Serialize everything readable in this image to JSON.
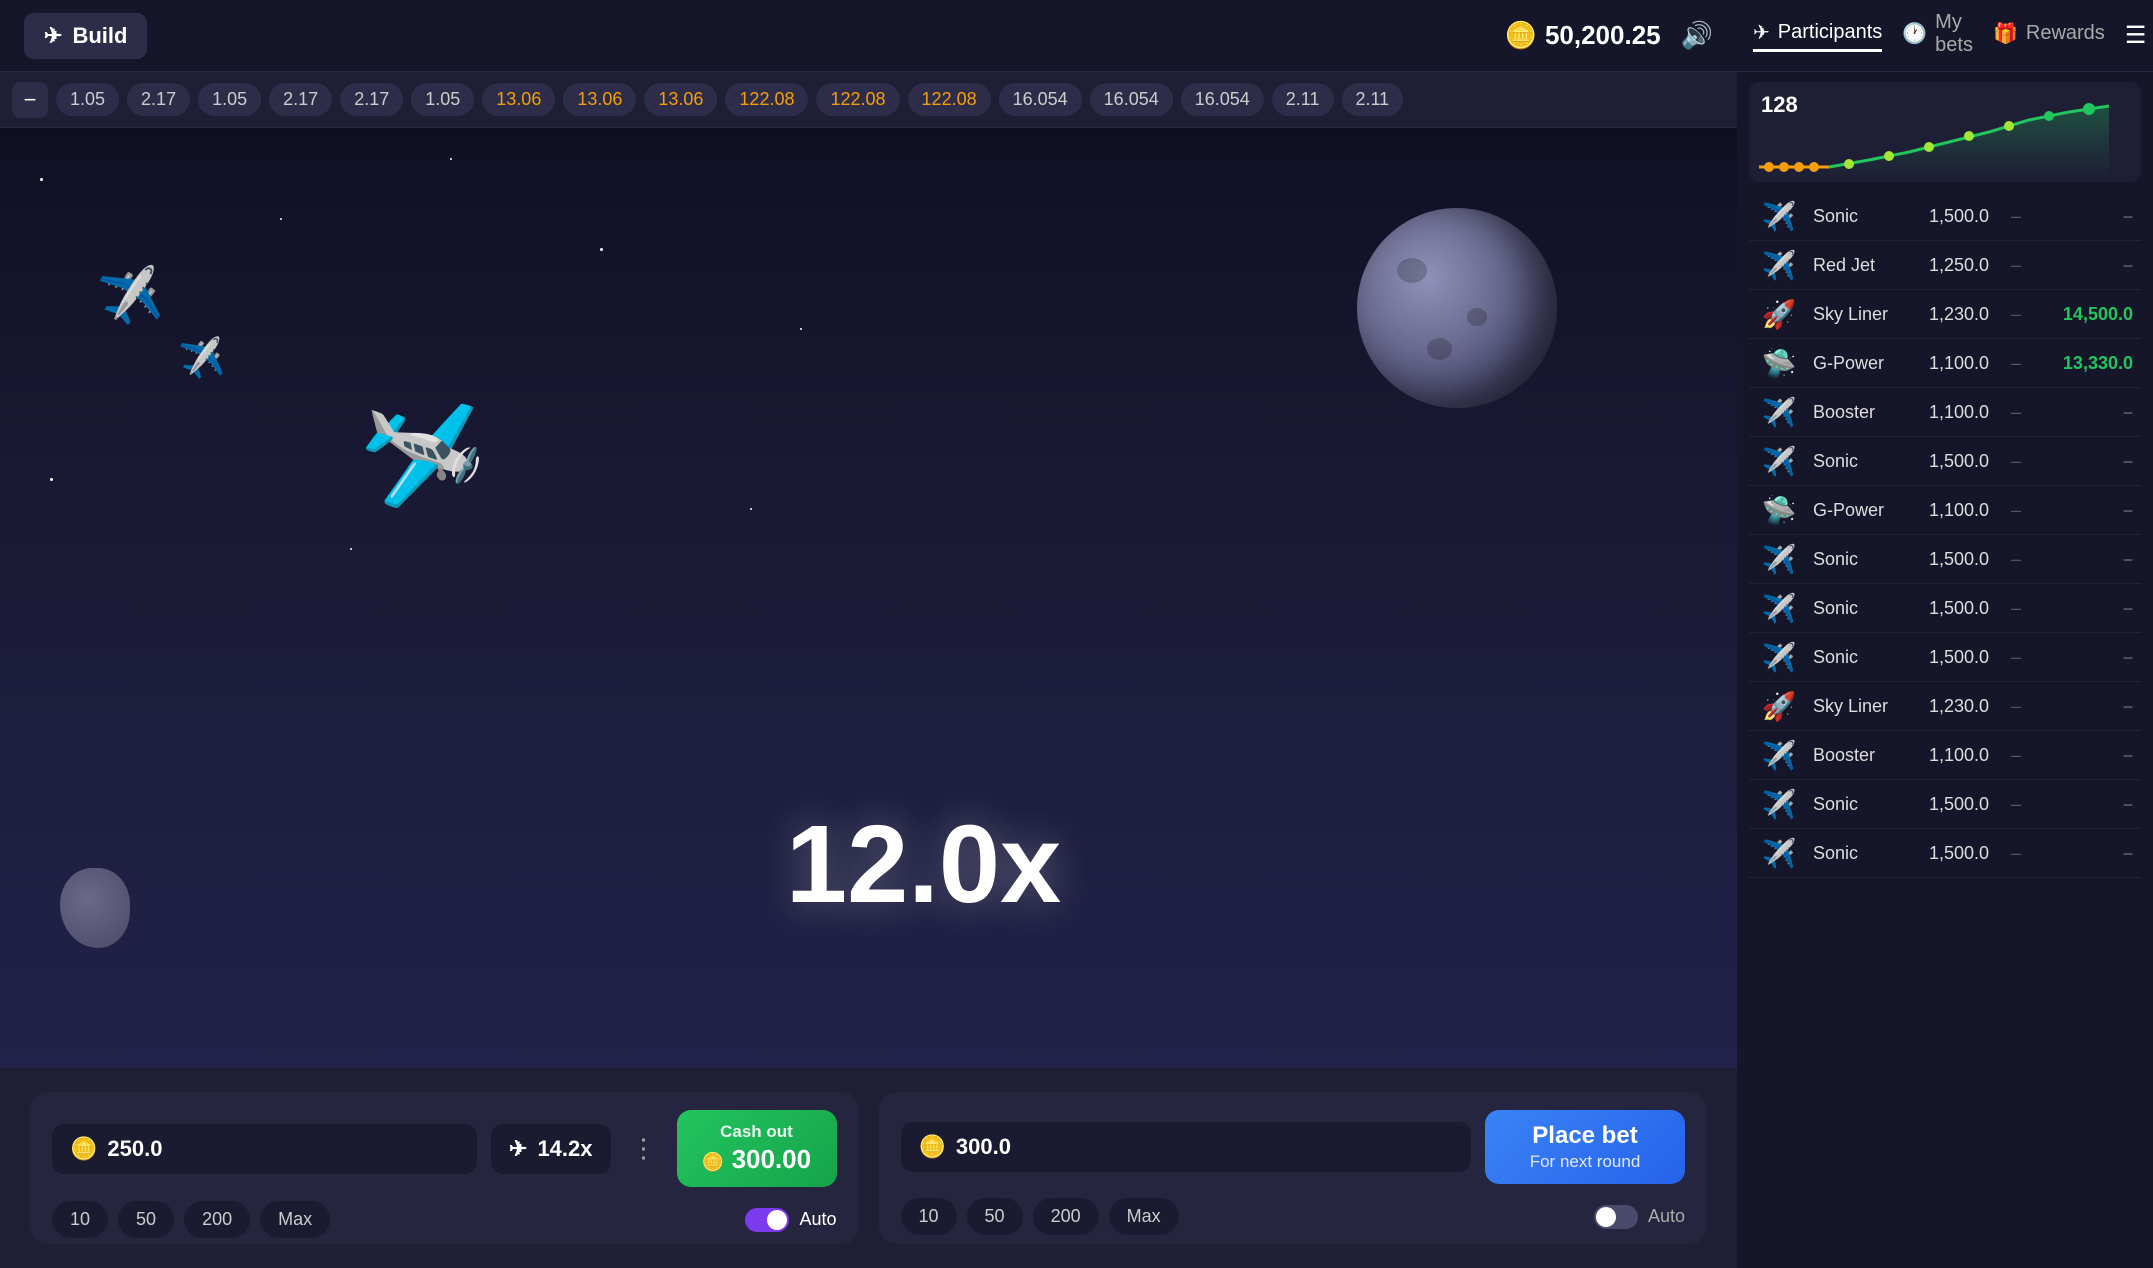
{
  "header": {
    "build_label": "Build",
    "balance": "50,200.25",
    "plane_icon": "✈",
    "coin_icon": "🪙",
    "sound_icon": "🔊"
  },
  "right_panel_tabs": [
    {
      "id": "participants",
      "label": "Participants",
      "icon": "✈",
      "active": true
    },
    {
      "id": "my_bets",
      "label": "My bets",
      "icon": "🕐",
      "active": false
    },
    {
      "id": "rewards",
      "label": "Rewards",
      "icon": "🎁",
      "active": false
    }
  ],
  "multiplier_strip": {
    "values": [
      "1.05",
      "2.17",
      "1.05",
      "2.17",
      "2.17",
      "1.05",
      "13.06",
      "13.06",
      "13.06",
      "122.08",
      "122.08",
      "122.08",
      "16.054",
      "16.054",
      "16.054",
      "2.11",
      "2.11"
    ]
  },
  "game": {
    "multiplier": "12.0x"
  },
  "chart": {
    "count": "128"
  },
  "bet_panel_1": {
    "amount": "250.0",
    "multiplier": "14.2x",
    "cashout_label": "Cash out",
    "cashout_amount": "300.00",
    "quick_bets": [
      "10",
      "50",
      "200",
      "Max"
    ],
    "auto_label": "Auto",
    "auto_on": true
  },
  "bet_panel_2": {
    "amount": "300.0",
    "place_bet_label": "Place bet",
    "place_bet_sub": "For next round",
    "quick_bets": [
      "10",
      "50",
      "200",
      "Max"
    ],
    "auto_label": "Auto",
    "auto_on": false
  },
  "participants": [
    {
      "name": "Sonic",
      "bet": "1,500.0",
      "dash1": "–",
      "win": "–"
    },
    {
      "name": "Red Jet",
      "bet": "1,250.0",
      "dash1": "–",
      "win": "–"
    },
    {
      "name": "Sky Liner",
      "bet": "1,230.0",
      "dash1": "–",
      "win": "14,500.0"
    },
    {
      "name": "G-Power",
      "bet": "1,100.0",
      "dash1": "–",
      "win": "13,330.0"
    },
    {
      "name": "Booster",
      "bet": "1,100.0",
      "dash1": "–",
      "win": "–"
    },
    {
      "name": "Sonic",
      "bet": "1,500.0",
      "dash1": "–",
      "win": "–"
    },
    {
      "name": "G-Power",
      "bet": "1,100.0",
      "dash1": "–",
      "win": "–"
    },
    {
      "name": "Sonic",
      "bet": "1,500.0",
      "dash1": "–",
      "win": "–"
    },
    {
      "name": "Sonic",
      "bet": "1,500.0",
      "dash1": "–",
      "win": "–"
    },
    {
      "name": "Sonic",
      "bet": "1,500.0",
      "dash1": "–",
      "win": "–"
    },
    {
      "name": "Sky Liner",
      "bet": "1,230.0",
      "dash1": "–",
      "win": "–"
    },
    {
      "name": "Booster",
      "bet": "1,100.0",
      "dash1": "–",
      "win": "–"
    },
    {
      "name": "Sonic",
      "bet": "1,500.0",
      "dash1": "–",
      "win": "–"
    },
    {
      "name": "Sonic",
      "bet": "1,500.0",
      "dash1": "–",
      "win": "–"
    }
  ],
  "plane_emojis": {
    "main": "🛩",
    "small1": "✈",
    "small2": "✈"
  }
}
